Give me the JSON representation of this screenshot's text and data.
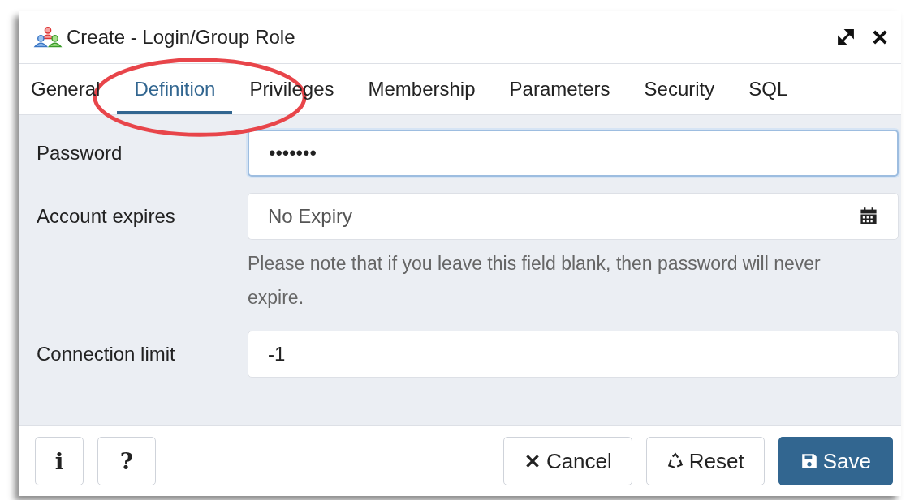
{
  "window": {
    "title": "Create - Login/Group Role"
  },
  "tabs": [
    {
      "label": "General",
      "selected": false
    },
    {
      "label": "Definition",
      "selected": true
    },
    {
      "label": "Privileges",
      "selected": false
    },
    {
      "label": "Membership",
      "selected": false
    },
    {
      "label": "Parameters",
      "selected": false
    },
    {
      "label": "Security",
      "selected": false
    },
    {
      "label": "SQL",
      "selected": false
    }
  ],
  "fields": [
    {
      "kind": "password",
      "label": "Password",
      "value": "•••••••",
      "focused": true
    },
    {
      "kind": "date",
      "label": "Account expires",
      "placeholder": "No Expiry",
      "help": "Please note that if you leave this field blank, then password will never expire.",
      "focused": false
    },
    {
      "kind": "text",
      "label": "Connection limit",
      "value": "-1",
      "focused": false
    }
  ],
  "footer": {
    "left_buttons": [
      {
        "kind": "info",
        "label": "i"
      },
      {
        "kind": "help",
        "label": "?"
      }
    ],
    "right_buttons": [
      {
        "kind": "cancel",
        "label": "Cancel"
      },
      {
        "kind": "reset",
        "label": "Reset"
      },
      {
        "kind": "save",
        "label": "Save"
      }
    ]
  }
}
